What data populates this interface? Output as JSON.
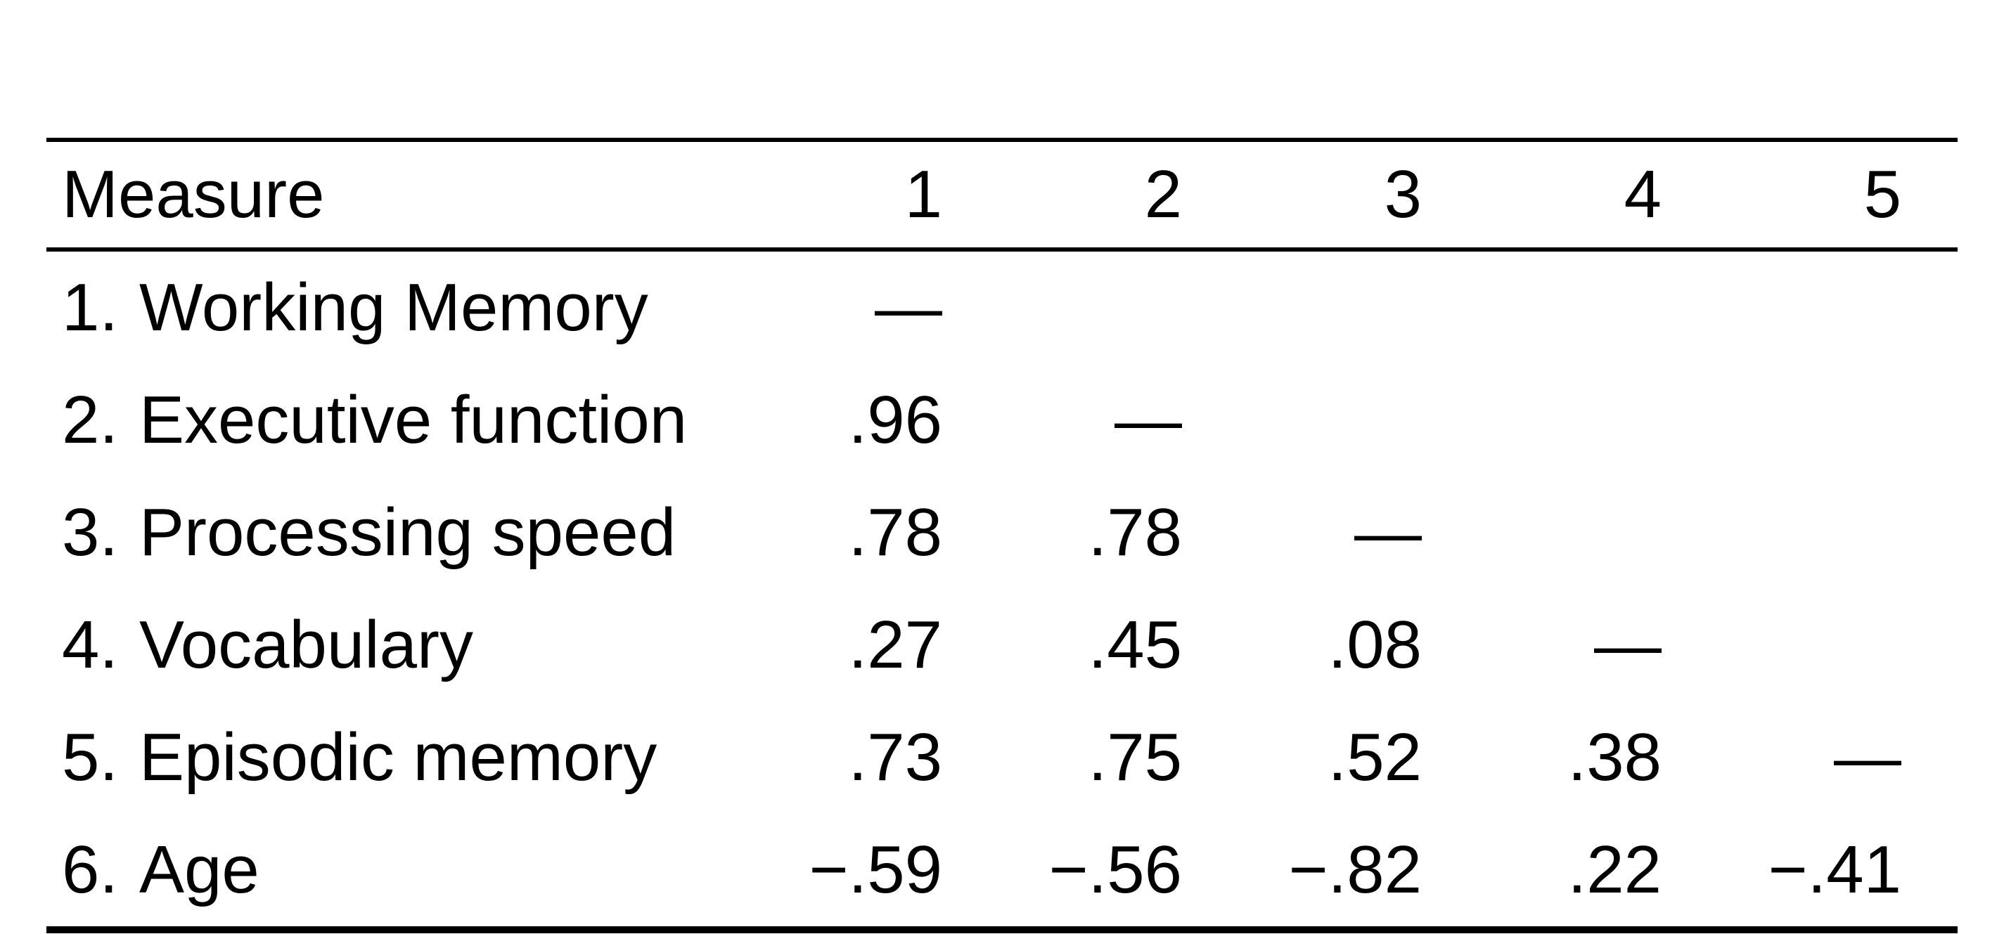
{
  "chart_data": {
    "type": "table",
    "title": "",
    "header": {
      "label": "Measure",
      "cols": [
        "1",
        "2",
        "3",
        "4",
        "5"
      ]
    },
    "rows": [
      {
        "n": "1.",
        "name": "Working Memory",
        "cells": [
          "—",
          "",
          "",
          "",
          ""
        ]
      },
      {
        "n": "2.",
        "name": "Executive function",
        "cells": [
          ".96",
          "—",
          "",
          "",
          ""
        ]
      },
      {
        "n": "3.",
        "name": "Processing speed",
        "cells": [
          ".78",
          ".78",
          "—",
          "",
          ""
        ]
      },
      {
        "n": "4.",
        "name": "Vocabulary",
        "cells": [
          ".27",
          ".45",
          ".08",
          "—",
          ""
        ]
      },
      {
        "n": "5.",
        "name": "Episodic memory",
        "cells": [
          ".73",
          ".75",
          ".52",
          ".38",
          "—"
        ]
      },
      {
        "n": "6.",
        "name": "Age",
        "cells": [
          "−.59",
          "−.56",
          "−.82",
          ".22",
          "−.41"
        ]
      }
    ]
  }
}
